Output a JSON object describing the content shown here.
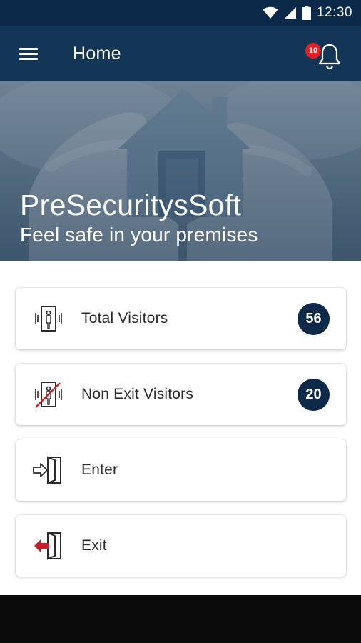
{
  "status_bar": {
    "time": "12:30"
  },
  "app_bar": {
    "title": "Home",
    "notification_count": "10"
  },
  "hero": {
    "title": "PreSecuritysSoft",
    "subtitle": "Feel safe in your premises"
  },
  "cards": [
    {
      "label": "Total Visitors",
      "count": "56",
      "icon": "walkthrough-scanner-icon"
    },
    {
      "label": "Non Exit Visitors",
      "count": "20",
      "icon": "crossed-scanner-icon"
    },
    {
      "label": "Enter",
      "icon": "door-enter-icon"
    },
    {
      "label": "Exit",
      "icon": "door-exit-icon"
    }
  ],
  "colors": {
    "primary": "#133656",
    "status_bar": "#0b2a4a",
    "badge": "#e32025",
    "count_bg": "#0e2a49",
    "exit_arrow": "#c8202a"
  }
}
